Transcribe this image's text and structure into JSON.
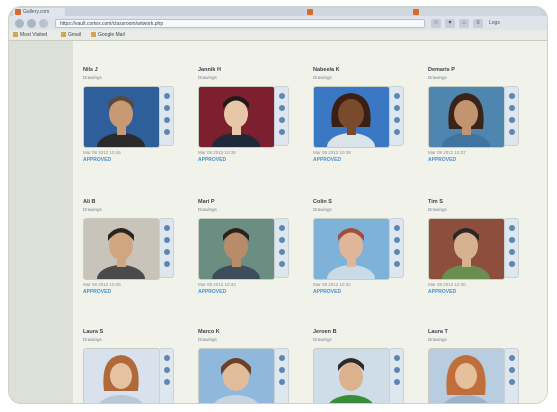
{
  "browser": {
    "tabs": [
      {
        "label": "Gallery.com"
      },
      {
        "label": ""
      },
      {
        "label": ""
      }
    ],
    "address": "https://vault.cortex.com/classroom/artwork.php",
    "toolbar_right": "Logs",
    "bookmarks": [
      {
        "label": "Most Visited"
      },
      {
        "label": "Gmail"
      },
      {
        "label": "Google Mail"
      }
    ]
  },
  "gallery": {
    "cards": [
      {
        "name": "Nils J",
        "category": "Drawings",
        "date": "Mar 08 2012 10:45",
        "status": "APPROVED",
        "colors": {
          "bg": "#2f5f9a",
          "skin": "#c79a74",
          "hair": "#5b4a3a",
          "shirt": "#2b2b2b"
        }
      },
      {
        "name": "Jannik H",
        "category": "Drawings",
        "date": "Mar 08 2012 10:38",
        "status": "APPROVED",
        "colors": {
          "bg": "#7c2030",
          "skin": "#e7c7a8",
          "hair": "#1f1a18",
          "shirt": "#1e2a3a"
        }
      },
      {
        "name": "Nabeela K",
        "category": "Drawings",
        "date": "Mar 08 2012 10:38",
        "status": "APPROVED",
        "colors": {
          "bg": "#3b78c4",
          "skin": "#7a4a2c",
          "hair": "#3a1f14",
          "shirt": "#d8e3ea"
        }
      },
      {
        "name": "Demaris P",
        "category": "Drawings",
        "date": "Mar 08 2012 10:37",
        "status": "APPROVED",
        "colors": {
          "bg": "#4f86b0",
          "skin": "#c29470",
          "hair": "#3a2418",
          "shirt": "#3f74a0"
        }
      },
      {
        "name": "Ali B",
        "category": "Drawings",
        "date": "Mar 08 2012 10:35",
        "status": "APPROVED",
        "colors": {
          "bg": "#c8c4ba",
          "skin": "#d1a57f",
          "hair": "#2a2420",
          "shirt": "#4a4a4a"
        }
      },
      {
        "name": "Mari P",
        "category": "Drawings",
        "date": "Mar 08 2012 10:33",
        "status": "APPROVED",
        "colors": {
          "bg": "#6b8e82",
          "skin": "#b98c69",
          "hair": "#2b2119",
          "shirt": "#3e4d5a"
        }
      },
      {
        "name": "Colin S",
        "category": "Drawings",
        "date": "Mar 08 2012 10:32",
        "status": "APPROVED",
        "colors": {
          "bg": "#7fb2d8",
          "skin": "#e0b698",
          "hair": "#a0503a",
          "shirt": "#c9dbe6"
        }
      },
      {
        "name": "Tim S",
        "category": "Drawings",
        "date": "Mar 08 2012 10:30",
        "status": "APPROVED",
        "colors": {
          "bg": "#8d4f3c",
          "skin": "#d7b291",
          "hair": "#2b2724",
          "shirt": "#6a8d50"
        }
      },
      {
        "name": "Laura S",
        "category": "Drawings",
        "date": "",
        "status": "",
        "colors": {
          "bg": "#d8e1ec",
          "skin": "#e6c2a0",
          "hair": "#b06a3a",
          "shirt": "#b8c8d8"
        }
      },
      {
        "name": "Marco K",
        "category": "Drawings",
        "date": "",
        "status": "",
        "colors": {
          "bg": "#8fb8dc",
          "skin": "#e2bc98",
          "hair": "#6a4028",
          "shirt": "#c8d4de"
        }
      },
      {
        "name": "Jeroen B",
        "category": "Drawings",
        "date": "",
        "status": "",
        "colors": {
          "bg": "#cfdde8",
          "skin": "#dcb28c",
          "hair": "#2f2a26",
          "shirt": "#3a8c3a"
        }
      },
      {
        "name": "Laura T",
        "category": "Drawings",
        "date": "",
        "status": "",
        "colors": {
          "bg": "#b8cde0",
          "skin": "#e6c09c",
          "hair": "#c06e3c",
          "shirt": "#9cb2c8"
        }
      }
    ]
  }
}
